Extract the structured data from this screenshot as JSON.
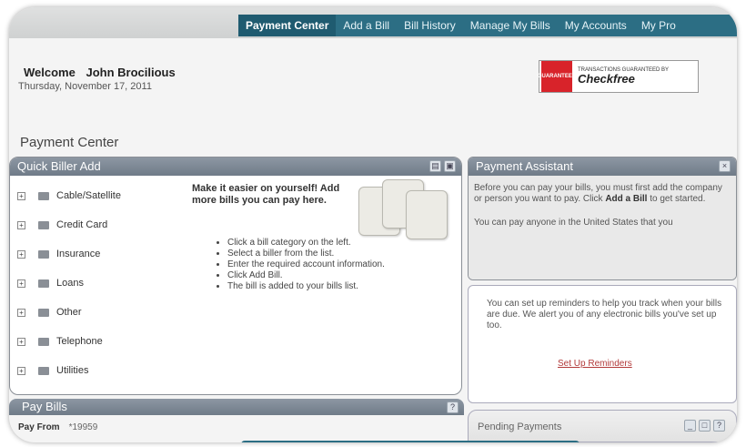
{
  "nav": {
    "tabs": [
      {
        "label": "Payment Center",
        "active": true
      },
      {
        "label": "Add a Bill",
        "active": false
      },
      {
        "label": "Bill History",
        "active": false
      },
      {
        "label": "Manage My Bills",
        "active": false
      },
      {
        "label": "My Accounts",
        "active": false
      },
      {
        "label": "My Pro",
        "active": false
      }
    ]
  },
  "header": {
    "welcome_label": "Welcome",
    "user_name": "John Brocilious",
    "date": "Thursday, November 17, 2011",
    "checkfree": {
      "seal_text": "GUARANTEED",
      "small_text": "TRANSACTIONS GUARANTEED BY",
      "brand": "Checkfree"
    }
  },
  "page_title": "Payment Center",
  "quick_biller": {
    "title": "Quick Biller Add",
    "categories": [
      "Cable/Satellite",
      "Credit Card",
      "Insurance",
      "Loans",
      "Other",
      "Telephone",
      "Utilities"
    ],
    "intro": "Make it easier on yourself! Add more bills you can pay here.",
    "steps": [
      "Click a bill category on the left.",
      "Select a biller from the list.",
      "Enter the required account information.",
      "Click Add Bill.",
      "The bill is added to your bills list."
    ]
  },
  "payment_assistant": {
    "title": "Payment Assistant",
    "text_before": "Before you can pay your bills, you must first add the company or person you want to pay. Click ",
    "text_bold": "Add a Bill",
    "text_after": " to get started.",
    "text2": "You can pay anyone in the United States that you",
    "reminder_text": "You can set up reminders to help you track when your bills are due. We alert you of any electronic bills you've set up too.",
    "reminder_link": "Set Up Reminders"
  },
  "pending_payments": {
    "title": "Pending Payments"
  },
  "pay_bills": {
    "title": "Pay Bills",
    "pay_from_label": "Pay From",
    "pay_from_value": "*19959"
  },
  "colors": {
    "nav": "#2c6e84",
    "panel_head": "#7a8591",
    "link": "#b23a3a"
  }
}
